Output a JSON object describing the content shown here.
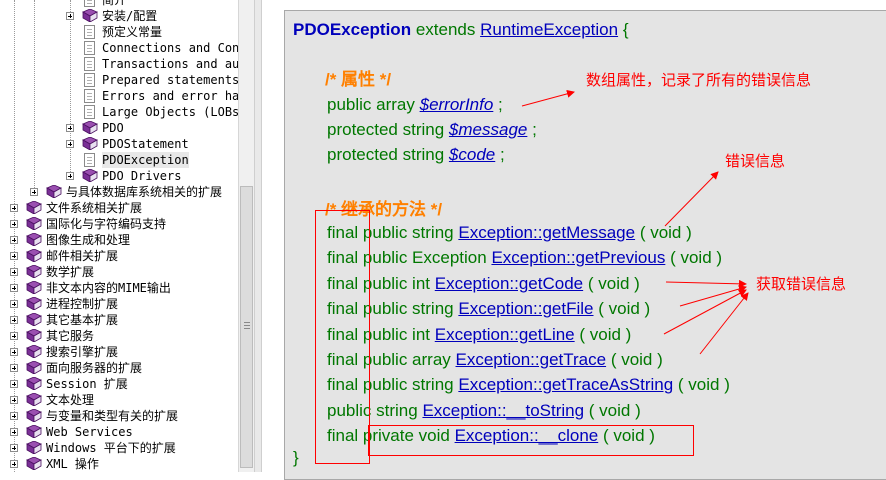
{
  "tree": {
    "nodes": [
      {
        "label": "简介",
        "icon": "page",
        "toggle": false
      },
      {
        "label": "安装/配置",
        "icon": "book",
        "toggle": true
      },
      {
        "label": "预定义常量",
        "icon": "page",
        "toggle": false
      },
      {
        "label": "Connections and Con",
        "icon": "page",
        "toggle": false
      },
      {
        "label": "Transactions and au",
        "icon": "page",
        "toggle": false
      },
      {
        "label": "Prepared statements",
        "icon": "page",
        "toggle": false
      },
      {
        "label": "Errors and error ha",
        "icon": "page",
        "toggle": false
      },
      {
        "label": "Large Objects (LOBs",
        "icon": "page",
        "toggle": false
      },
      {
        "label": "PDO",
        "icon": "book",
        "toggle": true
      },
      {
        "label": "PDOStatement",
        "icon": "book",
        "toggle": true
      },
      {
        "label": "PDOException",
        "icon": "page",
        "toggle": false,
        "selected": true
      },
      {
        "label": "PDO Drivers",
        "icon": "book",
        "toggle": true
      },
      {
        "label": "与具体数据库系统相关的扩展",
        "icon": "book",
        "toggle": true
      },
      {
        "label": "文件系统相关扩展",
        "icon": "book",
        "toggle": true
      },
      {
        "label": "国际化与字符编码支持",
        "icon": "book",
        "toggle": true
      },
      {
        "label": "图像生成和处理",
        "icon": "book",
        "toggle": true
      },
      {
        "label": "邮件相关扩展",
        "icon": "book",
        "toggle": true
      },
      {
        "label": "数学扩展",
        "icon": "book",
        "toggle": true
      },
      {
        "label": "非文本内容的MIME输出",
        "icon": "book",
        "toggle": true
      },
      {
        "label": "进程控制扩展",
        "icon": "book",
        "toggle": true
      },
      {
        "label": "其它基本扩展",
        "icon": "book",
        "toggle": true
      },
      {
        "label": "其它服务",
        "icon": "book",
        "toggle": true
      },
      {
        "label": "搜索引擎扩展",
        "icon": "book",
        "toggle": true
      },
      {
        "label": "面向服务器的扩展",
        "icon": "book",
        "toggle": true
      },
      {
        "label": "Session 扩展",
        "icon": "book",
        "toggle": true
      },
      {
        "label": "文本处理",
        "icon": "book",
        "toggle": true
      },
      {
        "label": "与变量和类型有关的扩展",
        "icon": "book",
        "toggle": true
      },
      {
        "label": "Web Services",
        "icon": "book",
        "toggle": true
      },
      {
        "label": "Windows 平台下的扩展",
        "icon": "book",
        "toggle": true
      },
      {
        "label": "XML 操作",
        "icon": "book",
        "toggle": true
      }
    ]
  },
  "code": {
    "class_name": "PDOException",
    "extends_kw": "extends",
    "parent_class": "RuntimeException",
    "open_brace": "{",
    "close_brace": "}",
    "props_comment": "/* 属性 */",
    "properties": [
      {
        "modifiers": "public array",
        "name": "$errorInfo",
        "end": ";"
      },
      {
        "modifiers": "protected string",
        "name": "$message",
        "end": ";"
      },
      {
        "modifiers": "protected string",
        "name": "$code",
        "end": ";"
      }
    ],
    "methods_comment": "/* 继承的方法 */",
    "methods": [
      {
        "modifiers": "final public string",
        "name": "Exception::getMessage",
        "params": "( void )"
      },
      {
        "modifiers": "final public Exception",
        "name": "Exception::getPrevious",
        "params": "( void )"
      },
      {
        "modifiers": "final public int",
        "name": "Exception::getCode",
        "params": "( void )"
      },
      {
        "modifiers": "final public string",
        "name": "Exception::getFile",
        "params": "( void )"
      },
      {
        "modifiers": "final public int",
        "name": "Exception::getLine",
        "params": "( void )"
      },
      {
        "modifiers": "final public array",
        "name": "Exception::getTrace",
        "params": "( void )"
      },
      {
        "modifiers": "final public string",
        "name": "Exception::getTraceAsString",
        "params": "( void )"
      },
      {
        "modifiers": "public string",
        "name": "Exception::__toString",
        "params": "( void )"
      },
      {
        "modifiers": "final private void",
        "name": "Exception::__clone",
        "params": "( void )"
      }
    ]
  },
  "annotations": {
    "error_info_note": "数组属性，记录了所有的错误信息",
    "error_message_note": "错误信息",
    "get_error_note": "获取错误信息"
  },
  "colors": {
    "annotation": "#ff0000",
    "code_keyword": "#007700",
    "code_link": "#0000bb",
    "code_comment": "#ff8000",
    "code_background": "#e4e4e4"
  }
}
